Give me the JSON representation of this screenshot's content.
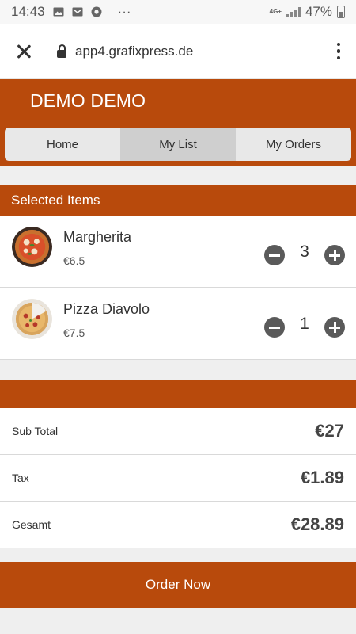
{
  "status_bar": {
    "time": "14:43",
    "more": "···",
    "network": "4G+",
    "battery": "47%"
  },
  "browser": {
    "url": "app4.grafixpress.de"
  },
  "app": {
    "title": "DEMO DEMO",
    "tabs": [
      {
        "label": "Home"
      },
      {
        "label": "My List"
      },
      {
        "label": "My Orders"
      }
    ],
    "active_tab": "My List"
  },
  "selected_items": {
    "heading": "Selected Items",
    "items": [
      {
        "name": "Margherita",
        "price": "€6.5",
        "quantity": "3"
      },
      {
        "name": "Pizza Diavolo",
        "price": "€7.5",
        "quantity": "1"
      }
    ]
  },
  "summary": {
    "rows": [
      {
        "label": "Sub Total",
        "value": "€27"
      },
      {
        "label": "Tax",
        "value": "€1.89"
      },
      {
        "label": "Gesamt",
        "value": "€28.89"
      }
    ]
  },
  "actions": {
    "order_label": "Order Now"
  },
  "colors": {
    "accent": "#b84a0c",
    "tab_active": "#cfcfcf",
    "background": "#efefef"
  }
}
